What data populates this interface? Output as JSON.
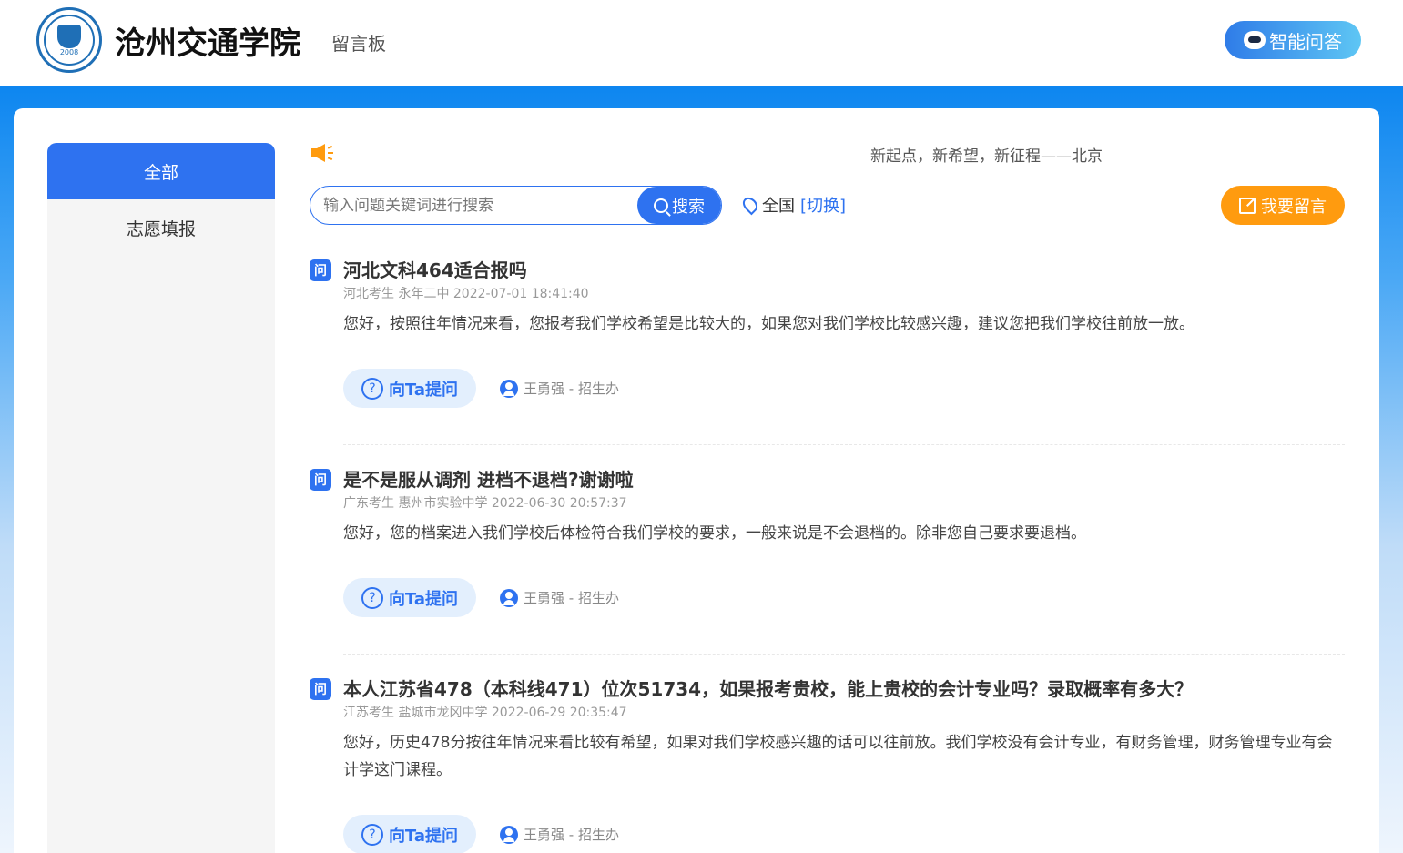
{
  "header": {
    "school_name": "沧州交通学院",
    "page_tag": "留言板",
    "ai_button": "智能问答",
    "logo_year": "2008"
  },
  "sidebar": {
    "items": [
      {
        "label": "全部",
        "active": true
      },
      {
        "label": "志愿填报",
        "active": false
      }
    ]
  },
  "notice": {
    "text": "新起点，新希望，新征程——北京"
  },
  "search": {
    "placeholder": "输入问题关键词进行搜索",
    "button": "搜索"
  },
  "location": {
    "region": "全国",
    "switch": "[切换]"
  },
  "post_button": "我要留言",
  "colors": {
    "primary": "#2e72f0",
    "orange": "#ff9b0f",
    "banner": "#0d86f0"
  },
  "questions": [
    {
      "icon": "问",
      "title": "河北文科464适合报吗",
      "meta": "河北考生 永年二中 2022-07-01 18:41:40",
      "answer": "您好，按照往年情况来看，您报考我们学校希望是比较大的，如果您对我们学校比较感兴趣，建议您把我们学校往前放一放。",
      "ask_label": "向Ta提问",
      "responder": "王勇强 - 招生办"
    },
    {
      "icon": "问",
      "title": "是不是服从调剂 进档不退档?谢谢啦",
      "meta": "广东考生 惠州市实验中学 2022-06-30 20:57:37",
      "answer": "您好，您的档案进入我们学校后体检符合我们学校的要求，一般来说是不会退档的。除非您自己要求要退档。",
      "ask_label": "向Ta提问",
      "responder": "王勇强 - 招生办"
    },
    {
      "icon": "问",
      "title": "本人江苏省478（本科线471）位次51734，如果报考贵校，能上贵校的会计专业吗？录取概率有多大？",
      "meta": "江苏考生 盐城市龙冈中学 2022-06-29 20:35:47",
      "answer": "您好，历史478分按往年情况来看比较有希望，如果对我们学校感兴趣的话可以往前放。我们学校没有会计专业，有财务管理，财务管理专业有会计学这门课程。",
      "ask_label": "向Ta提问",
      "responder": "王勇强 - 招生办"
    }
  ]
}
